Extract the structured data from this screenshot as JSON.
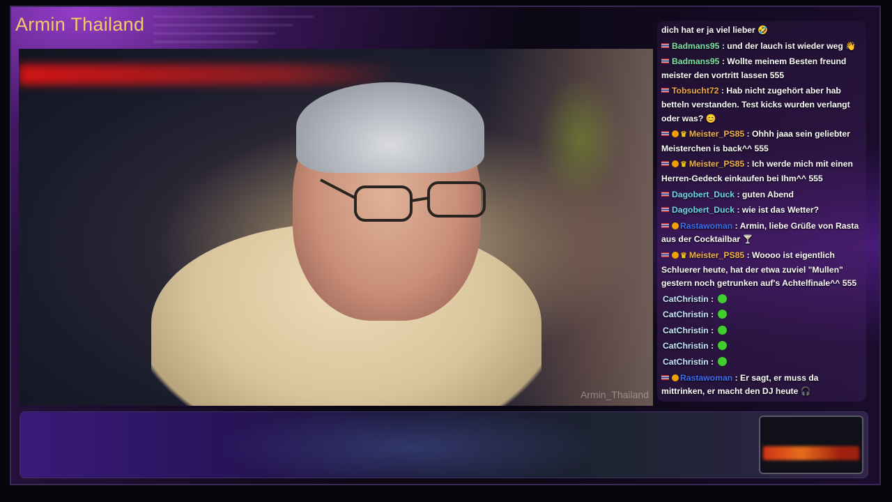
{
  "stream": {
    "title": "Armin Thailand",
    "watermark": "Armin_Thailand"
  },
  "chat": {
    "messages": [
      {
        "user": "",
        "text": "dich hat er ja viel lieber",
        "emote": "laughing-emoji"
      },
      {
        "user": "Badmans95",
        "text": ": und der lauch ist wieder weg",
        "emote": "hand-wave-emoji"
      },
      {
        "user": "Badmans95",
        "text": ": Wollte meinem Besten freund meister den vortritt lassen 555"
      },
      {
        "user": "Tobsucht72",
        "text": ": Hab nicht zugehört aber hab betteln verstanden. Test kicks wurden verlangt oder was?",
        "emote": "smile-emoji"
      },
      {
        "user": "Meister_PS85",
        "text": ": Ohhh jaaa sein geliebter Meisterchen is back^^ 555"
      },
      {
        "user": "Meister_PS85",
        "text": ": Ich werde mich mit einen Herren-Gedeck einkaufen bei Ihm^^ 555"
      },
      {
        "user": "Dagobert_Duck",
        "text": ": guten Abend"
      },
      {
        "user": "Dagobert_Duck",
        "text": ": wie ist das Wetter?"
      },
      {
        "user": "Rastawoman",
        "text": ": Armin, liebe Grüße von Rasta aus der Cocktailbar",
        "emote": "cocktail-emoji"
      },
      {
        "user": "Meister_PS85",
        "text": ": Woooo ist eigentlich Schluerer heute, hat der etwa zuviel \"Mullen\" gestern noch getrunken auf's Achtelfinale^^ 555"
      },
      {
        "user": "CatChristin",
        "text": " :"
      },
      {
        "user": "CatChristin",
        "text": " :"
      },
      {
        "user": "CatChristin",
        "text": " :"
      },
      {
        "user": "CatChristin",
        "text": " :"
      },
      {
        "user": "CatChristin",
        "text": " :"
      },
      {
        "user": "Rastawoman",
        "text": ": Er sagt, er muss da mittrinken, er macht den DJ heute",
        "emote": "dj-emoji"
      }
    ]
  },
  "colors": {
    "title": "#f5c96a",
    "badmans": "#7fe2a6",
    "tobsucht": "#f0a845",
    "meister": "#f2b24a",
    "dagobert": "#6fd6e8",
    "rastawoman": "#3b6ff0"
  }
}
